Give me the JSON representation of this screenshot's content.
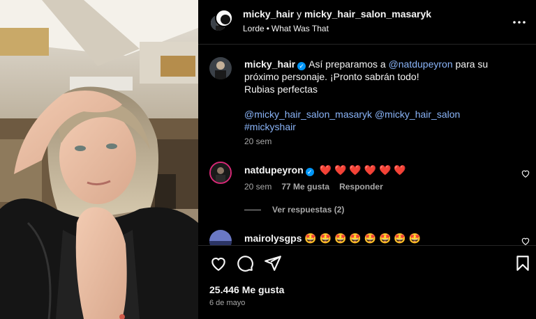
{
  "header": {
    "user1": "micky_hair",
    "joiner": "y",
    "user2": "micky_hair_salon_masaryk",
    "audio_artist": "Lorde",
    "audio_sep": "•",
    "audio_track": "What Was That"
  },
  "caption": {
    "username": "micky_hair",
    "text_1": "Así preparamos a ",
    "mention": "@natdupeyron",
    "text_2": " para su próximo personaje. ¡Pronto sabrán todo!",
    "line_2": "Rubias perfectas",
    "mention_line": "@micky_hair_salon_masaryk @micky_hair_salon",
    "hashtag": "#mickyshair",
    "time": "20 sem"
  },
  "comments": [
    {
      "username": "natdupeyron",
      "text": "❤️ ❤️ ❤️ ❤️ ❤️ ❤️",
      "time": "20 sem",
      "likes": "77 Me gusta",
      "reply": "Responder",
      "view_replies": "Ver respuestas (2)"
    },
    {
      "username": "mairolysgps",
      "text": "🤩 🤩 🤩 🤩 🤩 🤩 🤩 🤩"
    }
  ],
  "actions": {
    "likes": "25.446 Me gusta",
    "date": "6 de mayo"
  },
  "icons": {
    "more": "more-options-icon",
    "like": "heart-icon",
    "comment": "comment-icon",
    "share": "share-icon",
    "save": "bookmark-icon"
  },
  "colors": {
    "background": "#000000",
    "verified": "#0095f6",
    "heart_red": "#ff3040",
    "mention": "#e0f1ff"
  }
}
